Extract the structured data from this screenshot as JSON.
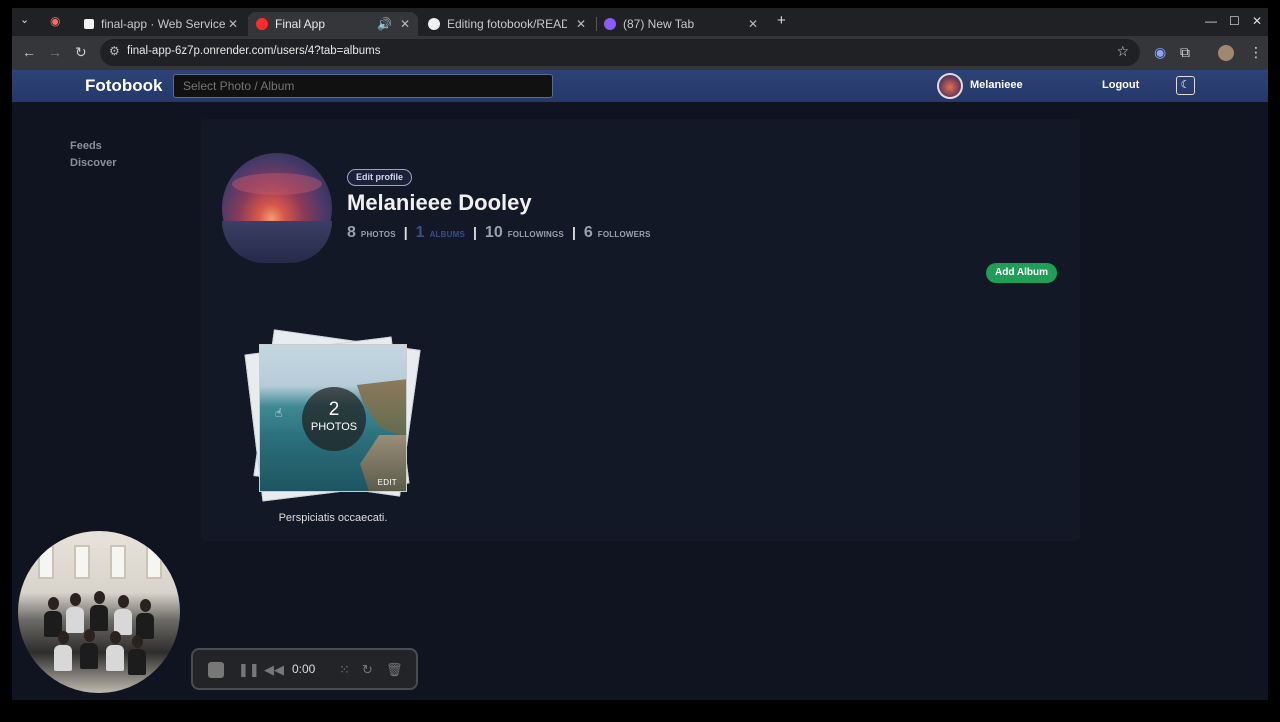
{
  "browser": {
    "tabs": [
      {
        "title": "final-app · Web Service",
        "favicon_color": "#f0f0f0"
      },
      {
        "title": "Final App",
        "favicon_color": "#ff2a2a",
        "active": true
      },
      {
        "title": "Editing fotobook/READM",
        "favicon_color": "#f0f0f0"
      },
      {
        "title": "(87) New Tab",
        "favicon_color": "#8b5cf6"
      }
    ],
    "url": "final-app-6z7p.onrender.com/users/4?tab=albums"
  },
  "navbar": {
    "brand": "Fotobook",
    "search_placeholder": "Select Photo / Album",
    "username": "Melanieee",
    "logout": "Logout",
    "theme_icon": "☾"
  },
  "sidebar": {
    "items": [
      {
        "label": "Feeds"
      },
      {
        "label": "Discover"
      }
    ]
  },
  "profile": {
    "edit_label": "Edit profile",
    "name": "Melanieee Dooley",
    "stats": [
      {
        "value": "8",
        "label": "PHOTOS"
      },
      {
        "value": "1",
        "label": "ALBUMS"
      },
      {
        "value": "10",
        "label": "FOLLOWINGS"
      },
      {
        "value": "6",
        "label": "FOLLOWERS"
      }
    ],
    "add_album_label": "Add Album"
  },
  "album": {
    "count": "2",
    "count_label": "PHOTOS",
    "edit_label": "EDIT",
    "title": "Perspiciatis occaecati."
  },
  "recorder": {
    "time": "0:00"
  },
  "colors": {
    "accent_green": "#1e9e56",
    "navbar_blue": "#2d4276",
    "active_stat": "#3b4e86"
  }
}
